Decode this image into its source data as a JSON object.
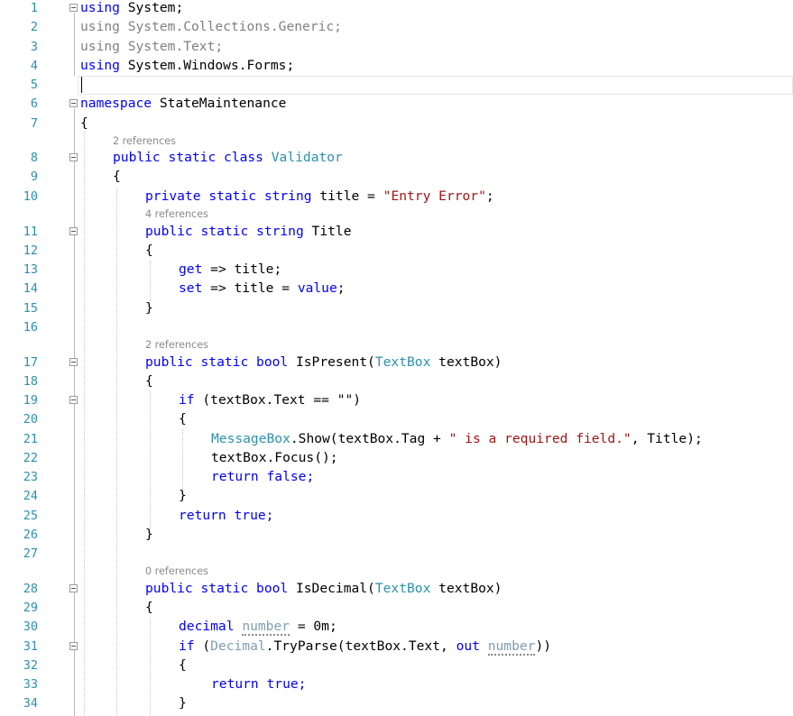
{
  "editor": {
    "line_numbers": [
      "1",
      "2",
      "3",
      "4",
      "5",
      "6",
      "7",
      "8",
      "9",
      "10",
      "11",
      "12",
      "13",
      "14",
      "15",
      "16",
      "17",
      "18",
      "19",
      "20",
      "21",
      "22",
      "23",
      "24",
      "25",
      "26",
      "27",
      "28",
      "29",
      "30",
      "31",
      "32",
      "33",
      "34"
    ],
    "codelens": {
      "validator": "2 references",
      "title": "4 references",
      "is_present": "2 references",
      "is_decimal": "0 references"
    },
    "tokens": {
      "using": "using",
      "system": "System;",
      "collections": "System.Collections.Generic;",
      "text": "System.Text;",
      "forms": "System.Windows.Forms;",
      "namespace": "namespace",
      "ns_name": "StateMaintenance",
      "open_brace": "{",
      "close_brace": "}",
      "public": "public",
      "private": "private",
      "static": "static",
      "class": "class",
      "class_name": "Validator",
      "string": "string",
      "title_field": "title =",
      "entry_error": "\"Entry Error\"",
      "semicolon": ";",
      "prop_title": "Title",
      "get": "get",
      "set": "set",
      "get_body": "=> title;",
      "set_body_a": "=> title =",
      "value": "value",
      "bool": "bool",
      "is_present": "IsPresent(",
      "is_decimal": "IsDecimal(",
      "textbox_type": "TextBox",
      "param": "textBox)",
      "if": "if",
      "if_cond": "(textBox.Text == \"\")",
      "messagebox": "MessageBox",
      "show": ".Show(textBox.Tag +",
      "required": "\" is a required field.\"",
      "title_arg": ", Title);",
      "focus": "textBox.Focus();",
      "return": "return",
      "true": "true;",
      "false": "false;",
      "decimal": "decimal",
      "number": "number",
      "assign_zero": "= 0m;",
      "decimal_type": "Decimal",
      "tryparse": ".TryParse(textBox.Text,",
      "out": "out",
      "close_paren": "))"
    }
  }
}
